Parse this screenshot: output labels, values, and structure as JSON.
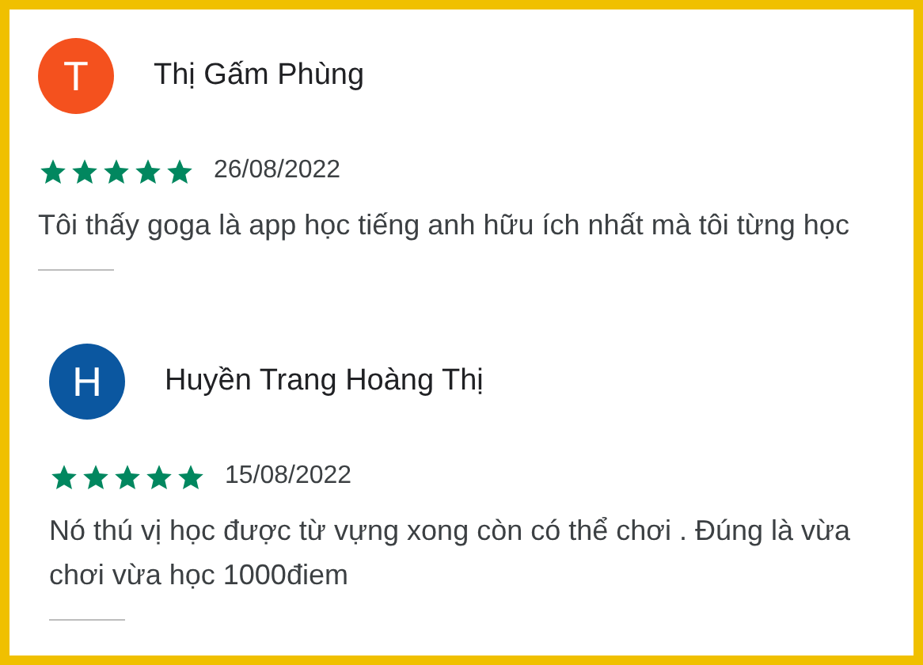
{
  "reviews": [
    {
      "avatar_letter": "T",
      "color": "#f4511e",
      "name": "Thị Gấm Phùng",
      "stars": 5,
      "date": "26/08/2022",
      "text": "Tôi thấy goga là app học tiếng anh hữu ích nhất mà tôi từng học"
    },
    {
      "avatar_letter": "H",
      "color": "#0b57a0",
      "name": "Huyền Trang Hoàng Thị",
      "stars": 5,
      "date": "15/08/2022",
      "text": "Nó thú vị học được từ vựng xong còn có thể chơi . Đúng là vừa chơi vừa học 1000điem"
    }
  ]
}
